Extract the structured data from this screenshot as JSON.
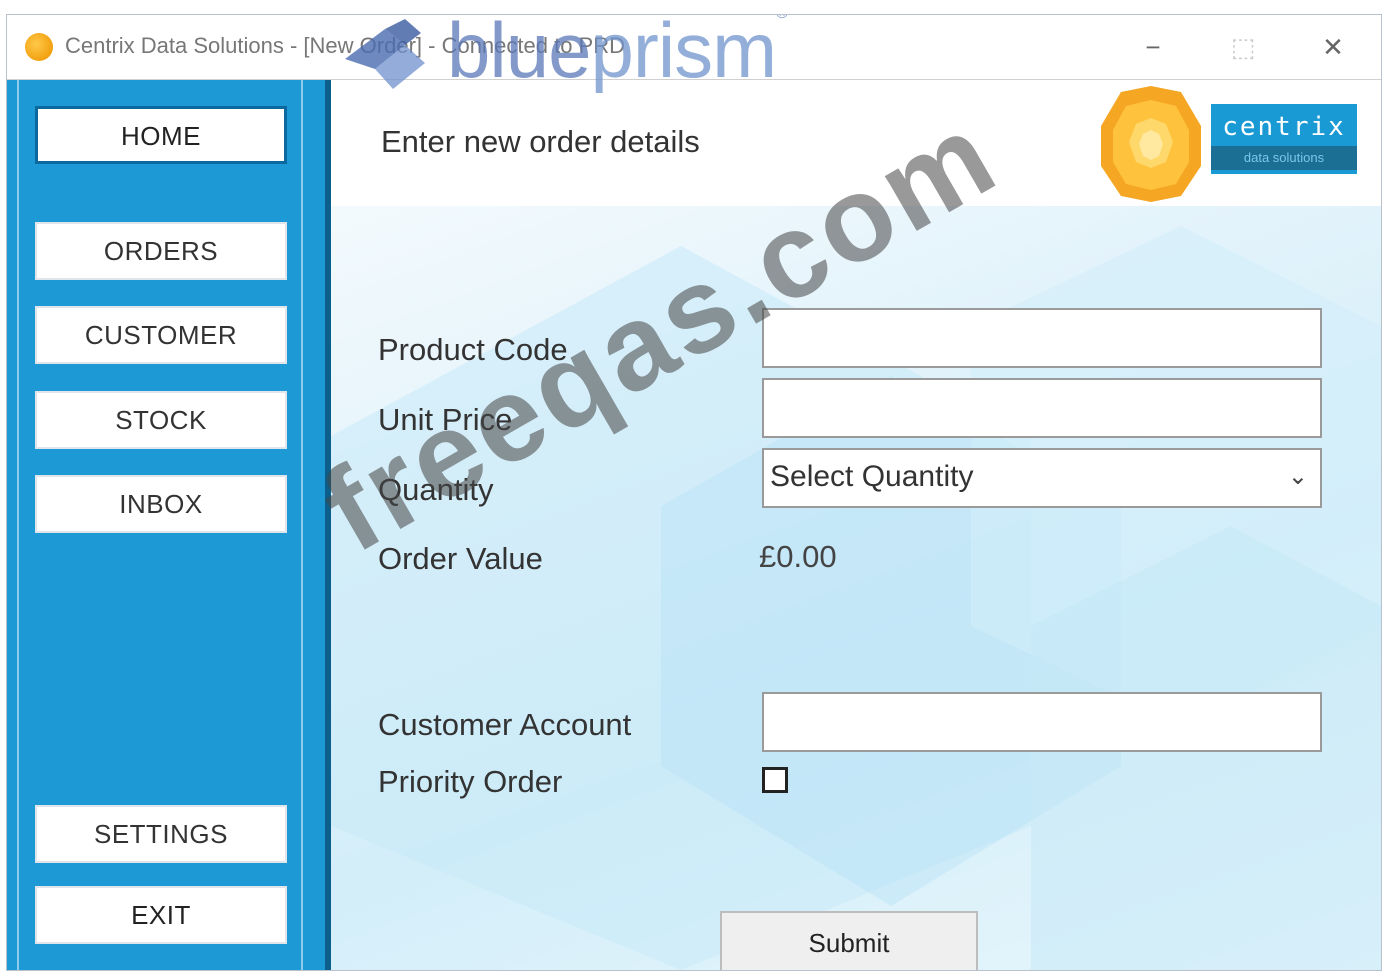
{
  "window": {
    "title": "Centrix Data Solutions - [New Order] - Connected to PRD",
    "controls": {
      "minimize": "−",
      "maximize": "⬚",
      "close": "✕"
    }
  },
  "brand_watermark": {
    "name_part1": "blue",
    "name_part2": "prism",
    "trademark": "®"
  },
  "sidebar": {
    "items": [
      {
        "label": "HOME"
      },
      {
        "label": "ORDERS"
      },
      {
        "label": "CUSTOMER"
      },
      {
        "label": "STOCK"
      },
      {
        "label": "INBOX"
      },
      {
        "label": "SETTINGS"
      },
      {
        "label": "EXIT"
      }
    ]
  },
  "main": {
    "title": "Enter new order details",
    "logo": {
      "name": "centrix",
      "tagline": "data solutions"
    },
    "form": {
      "product_code": {
        "label": "Product Code",
        "value": ""
      },
      "unit_price": {
        "label": "Unit Price",
        "value": ""
      },
      "quantity": {
        "label": "Quantity",
        "selected": "Select Quantity"
      },
      "order_value": {
        "label": "Order Value",
        "value": "£0.00"
      },
      "customer_account": {
        "label": "Customer Account",
        "value": ""
      },
      "priority_order": {
        "label": "Priority Order",
        "checked": false
      },
      "submit_label": "Submit"
    }
  },
  "overlay_watermark": "freeqas.com",
  "colors": {
    "sidebar_bg": "#1d9ad6",
    "sidebar_border": "#0c5f8a",
    "logo_blue": "#1a9ad5",
    "logo_orange": "#f5a623"
  }
}
